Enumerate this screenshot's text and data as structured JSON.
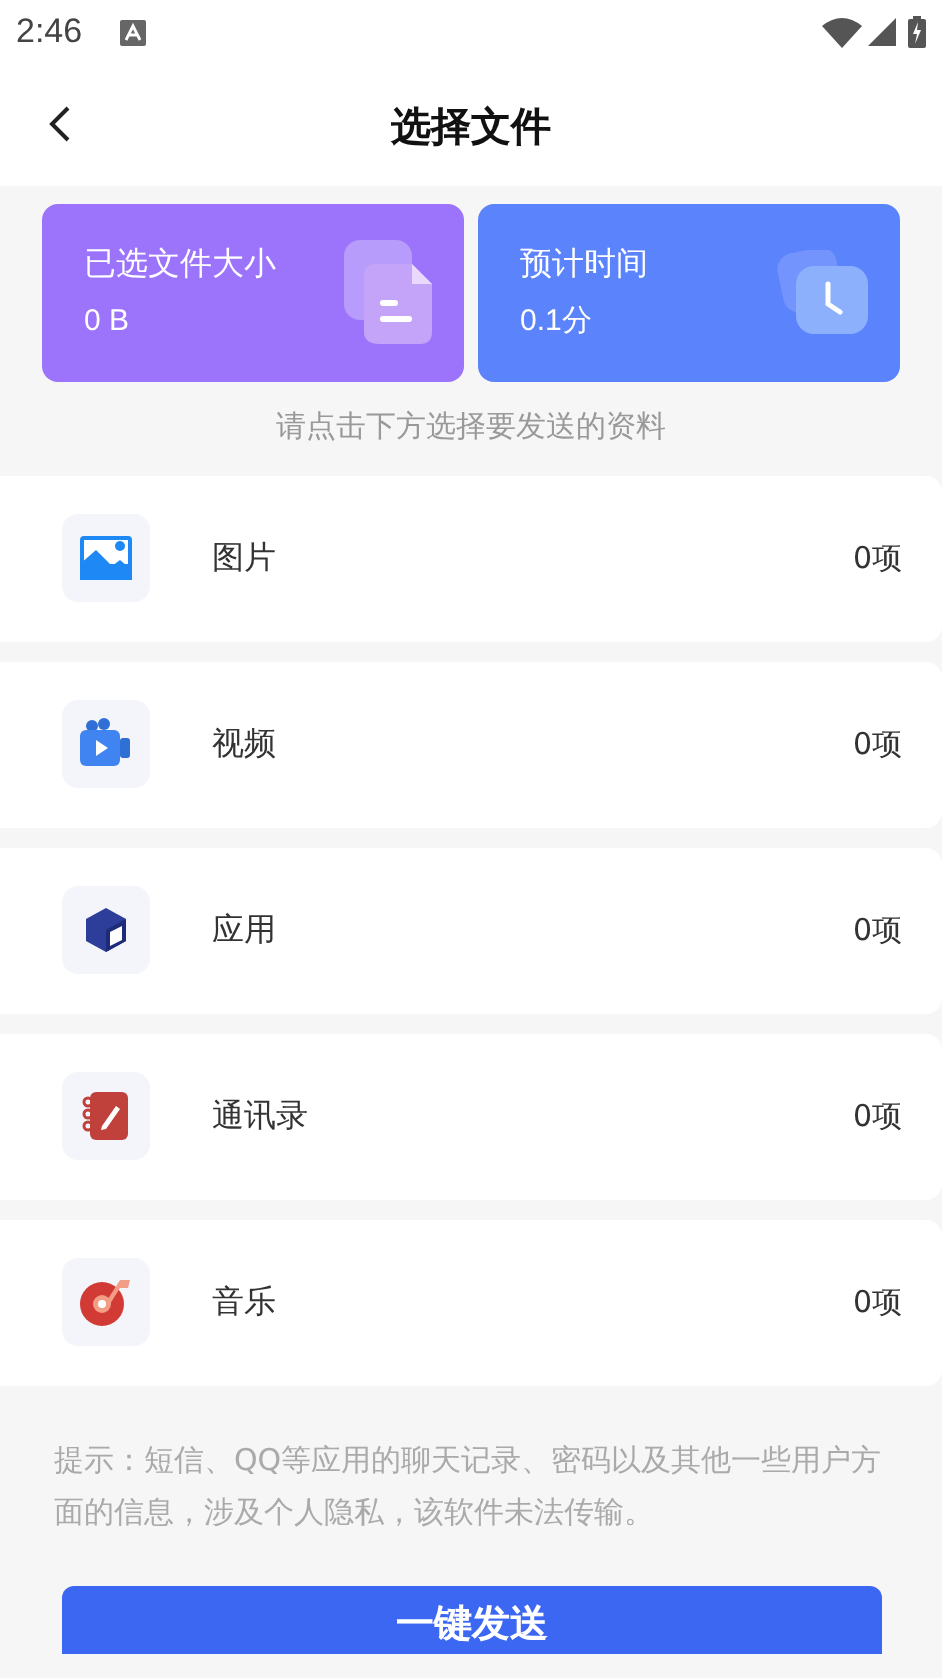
{
  "status_bar": {
    "time": "2:46"
  },
  "header": {
    "title": "选择文件"
  },
  "summary_cards": [
    {
      "kind": "size",
      "label": "已选文件大小",
      "value": "0 B"
    },
    {
      "kind": "time",
      "label": "预计时间",
      "value": "0.1分"
    }
  ],
  "instruction": "请点击下方选择要发送的资料",
  "categories": [
    {
      "kind": "image",
      "label": "图片",
      "count": "0项"
    },
    {
      "kind": "video",
      "label": "视频",
      "count": "0项"
    },
    {
      "kind": "app",
      "label": "应用",
      "count": "0项"
    },
    {
      "kind": "contacts",
      "label": "通讯录",
      "count": "0项"
    },
    {
      "kind": "music",
      "label": "音乐",
      "count": "0项"
    }
  ],
  "notice": "提示：短信、QQ等应用的聊天记录、密码以及其他一些用户方面的信息，涉及个人隐私，该软件未法传输。",
  "send_button": "一键发送"
}
